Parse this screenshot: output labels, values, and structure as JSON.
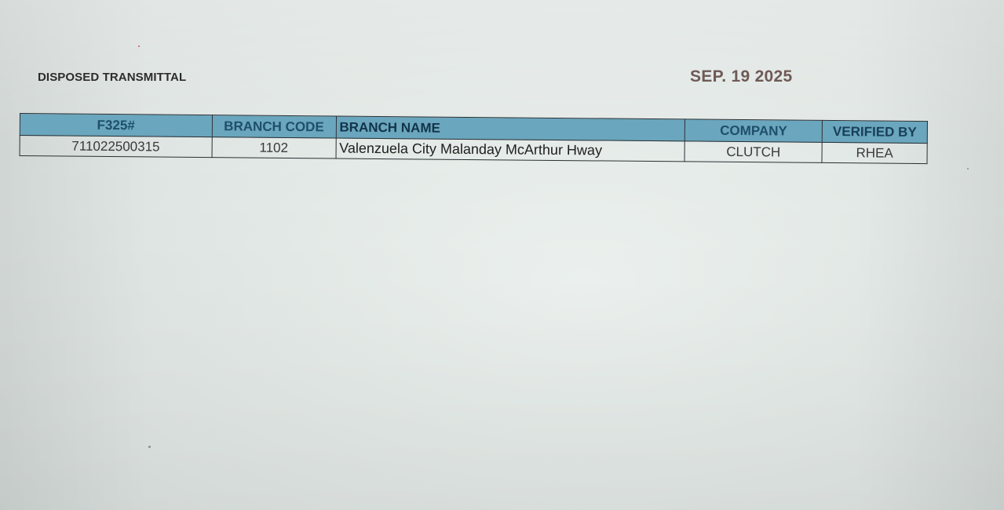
{
  "document": {
    "title": "DISPOSED TRANSMITTAL",
    "date": "SEP. 19 2025"
  },
  "table": {
    "headers": [
      "F325#",
      "BRANCH CODE",
      "BRANCH NAME",
      "COMPANY",
      "VERIFIED BY"
    ],
    "rows": [
      [
        "711022500315",
        "1102",
        "Valenzuela City Malanday McArthur Hway",
        "CLUTCH",
        "RHEA"
      ]
    ]
  },
  "colors": {
    "header_fill": "#6aa6bd",
    "header_text": "#1f4f6a",
    "date_text": "#6e5a55",
    "paper": "#e5ebe8"
  }
}
